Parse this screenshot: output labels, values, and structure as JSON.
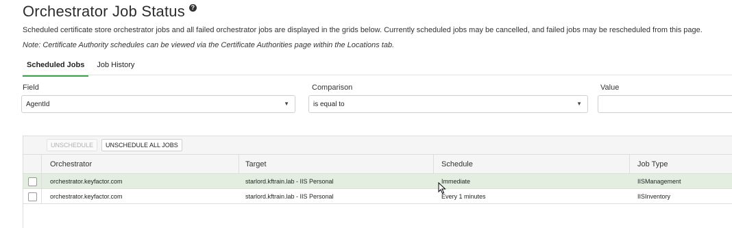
{
  "page": {
    "title": "Orchestrator Job Status",
    "description": "Scheduled certificate store orchestrator jobs and all failed orchestrator jobs are displayed in the grids below. Currently scheduled jobs may be cancelled, and failed jobs may be rescheduled from this page.",
    "note": "Note: Certificate Authority schedules can be viewed via the Certificate Authorities page within the Locations tab."
  },
  "tabs": [
    {
      "label": "Scheduled Jobs",
      "active": true
    },
    {
      "label": "Job History",
      "active": false
    }
  ],
  "filter": {
    "field_label": "Field",
    "field_value": "AgentId",
    "comparison_label": "Comparison",
    "comparison_value": "is equal to",
    "value_label": "Value",
    "value_value": ""
  },
  "toolbar": {
    "unschedule": "UNSCHEDULE",
    "unschedule_all": "UNSCHEDULE ALL JOBS"
  },
  "grid": {
    "columns": [
      "Orchestrator",
      "Target",
      "Schedule",
      "Job Type"
    ],
    "rows": [
      {
        "orchestrator": "orchestrator.keyfactor.com",
        "target": "starlord.kftrain.lab - IIS Personal",
        "schedule": "Immediate",
        "job_type": "IISManagement",
        "highlighted": true
      },
      {
        "orchestrator": "orchestrator.keyfactor.com",
        "target": "starlord.kftrain.lab - IIS Personal",
        "schedule": "Every 1 minutes",
        "job_type": "IISInventory",
        "highlighted": false
      }
    ]
  },
  "colors": {
    "accent": "#3aa24a",
    "row_highlight": "#e3eee0"
  },
  "icons": {
    "help": "help-circle-icon",
    "caret": "chevron-down-icon",
    "cursor": "mouse-pointer-icon"
  }
}
